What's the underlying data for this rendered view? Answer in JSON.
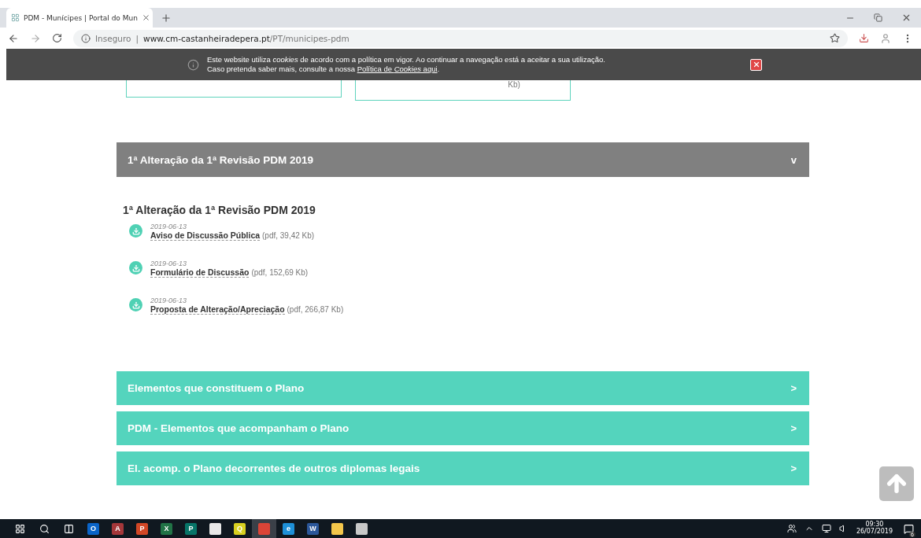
{
  "browser": {
    "tab_title": "PDM - Munícipes | Portal do Mun",
    "security": "Inseguro",
    "separator": "|",
    "url_host": "www.cm-castanheiradepera.pt",
    "url_path": "/PT/municipes-pdm"
  },
  "cookie_notice": {
    "text": "Este website utiliza *cookies* de acordo com a política em vigor. Ao continuar a navegação está a aceitar a sua utilização. Caso pretenda saber mais, consulte a nossa ",
    "link": "Política de *Cookies* aqui",
    "end": "."
  },
  "cards": [
    {
      "kind": "short"
    },
    {
      "kind": "tall",
      "meta": "Kb)"
    }
  ],
  "sections": [
    {
      "title": "1ª Alteração da 1ª Revisão PDM 2019",
      "expanded": true,
      "toggle": "v",
      "heading": "1ª Alteração da 1ª Revisão PDM 2019",
      "files": [
        {
          "date": "2019-06-13",
          "name": "Aviso de Discussão Pública",
          "meta": "(pdf, 39,42 Kb)"
        },
        {
          "date": "2019-06-13",
          "name": "Formulário de Discussão",
          "meta": "(pdf, 152,69 Kb)"
        },
        {
          "date": "2019-06-13",
          "name": "Proposta de Alteração/Apreciação",
          "meta": "(pdf, 266,87 Kb)"
        }
      ]
    },
    {
      "title": "Elementos que constituem o Plano",
      "expanded": false,
      "toggle": ">"
    },
    {
      "title": "PDM - Elementos que acompanham o Plano",
      "expanded": false,
      "toggle": ">"
    },
    {
      "title": "El. acomp. o Plano decorrentes de outros diplomas legais",
      "expanded": false,
      "toggle": ">"
    }
  ],
  "taskbar": {
    "apps": [
      {
        "letter": "O",
        "color": "#0a64c8",
        "selected": false
      },
      {
        "letter": "A",
        "color": "#a4373a",
        "selected": false
      },
      {
        "letter": "P",
        "color": "#d24726",
        "selected": false
      },
      {
        "letter": "X",
        "color": "#217346",
        "selected": false
      },
      {
        "letter": "P",
        "color": "#077568",
        "selected": false
      },
      {
        "color": "#e8e8e8",
        "selected": false
      },
      {
        "letter": "Q",
        "color": "#d8d020",
        "selected": false
      },
      {
        "color": "#db4437",
        "selected": true
      },
      {
        "letter": "e",
        "color": "#1e90d8",
        "selected": false
      },
      {
        "letter": "W",
        "color": "#2b579a",
        "selected": false
      },
      {
        "color": "#f3c64b",
        "selected": false
      },
      {
        "color": "#c8c8c8",
        "selected": false
      }
    ],
    "time": "09:30",
    "date": "26/07/2019",
    "notifications": "6"
  }
}
